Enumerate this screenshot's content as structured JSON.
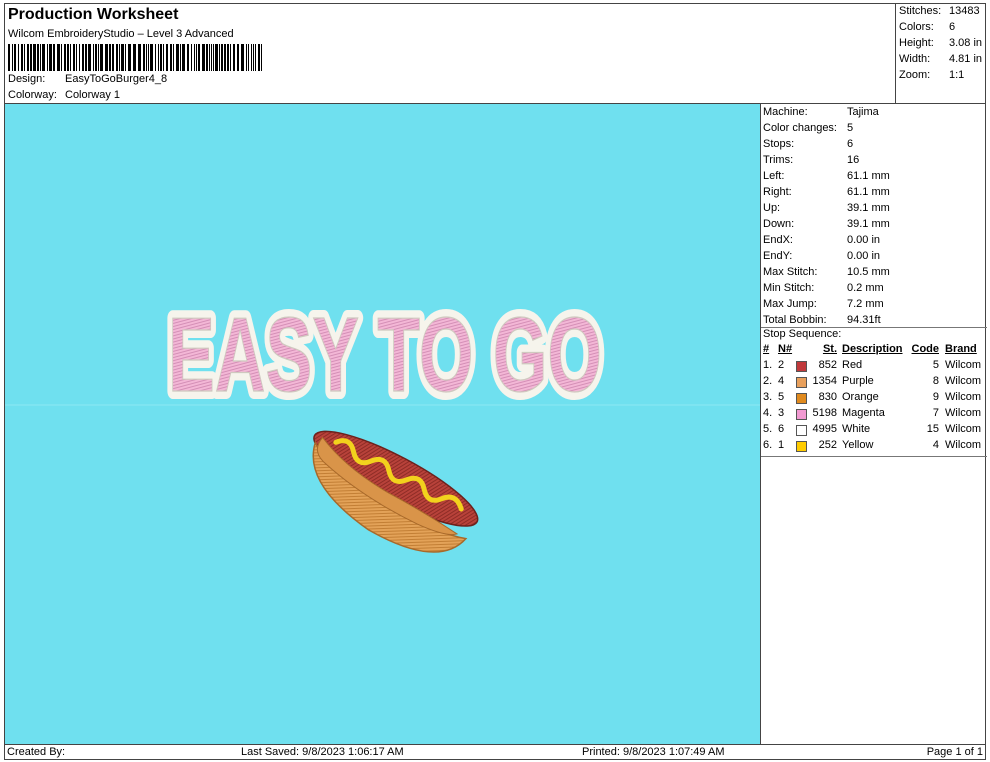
{
  "header": {
    "title": "Production Worksheet",
    "software": "Wilcom EmbroideryStudio – Level 3 Advanced",
    "design_label": "Design:",
    "design_value": "EasyToGoBurger4_8",
    "colorway_label": "Colorway:",
    "colorway_value": "Colorway 1"
  },
  "summary": [
    {
      "label": "Stitches:",
      "value": "13483"
    },
    {
      "label": "Colors:",
      "value": "6"
    },
    {
      "label": "Height:",
      "value": "3.08 in"
    },
    {
      "label": "Width:",
      "value": "4.81 in"
    },
    {
      "label": "Zoom:",
      "value": "1:1"
    }
  ],
  "info": [
    {
      "label": "Machine:",
      "value": "Tajima"
    },
    {
      "label": "Color changes:",
      "value": "5"
    },
    {
      "label": "Stops:",
      "value": "6"
    },
    {
      "label": "Trims:",
      "value": "16"
    },
    {
      "label": "Left:",
      "value": "61.1 mm"
    },
    {
      "label": "Right:",
      "value": "61.1 mm"
    },
    {
      "label": "Up:",
      "value": "39.1 mm"
    },
    {
      "label": "Down:",
      "value": "39.1 mm"
    },
    {
      "label": "EndX:",
      "value": "0.00 in"
    },
    {
      "label": "EndY:",
      "value": "0.00 in"
    },
    {
      "label": "Max Stitch:",
      "value": "10.5 mm"
    },
    {
      "label": "Min Stitch:",
      "value": "0.2 mm"
    },
    {
      "label": "Max Jump:",
      "value": "7.2 mm"
    },
    {
      "label": "Total Bobbin:",
      "value": "94.31ft"
    }
  ],
  "stop_sequence": {
    "title": "Stop Sequence:",
    "headers": {
      "idx": "#",
      "n": "N#",
      "st": "St.",
      "desc": "Description",
      "code": "Code",
      "brand": "Brand"
    },
    "rows": [
      {
        "idx": "1.",
        "n": "2",
        "color": "#c0393b",
        "st": "852",
        "desc": "Red",
        "code": "5",
        "brand": "Wilcom"
      },
      {
        "idx": "2.",
        "n": "4",
        "color": "#e8a05c",
        "st": "1354",
        "desc": "Purple",
        "code": "8",
        "brand": "Wilcom"
      },
      {
        "idx": "3.",
        "n": "5",
        "color": "#e08a1e",
        "st": "830",
        "desc": "Orange",
        "code": "9",
        "brand": "Wilcom"
      },
      {
        "idx": "4.",
        "n": "3",
        "color": "#f29ad2",
        "st": "5198",
        "desc": "Magenta",
        "code": "7",
        "brand": "Wilcom"
      },
      {
        "idx": "5.",
        "n": "6",
        "color": "#ffffff",
        "st": "4995",
        "desc": "White",
        "code": "15",
        "brand": "Wilcom"
      },
      {
        "idx": "6.",
        "n": "1",
        "color": "#ffcc00",
        "st": "252",
        "desc": "Yellow",
        "code": "4",
        "brand": "Wilcom"
      }
    ]
  },
  "design_artwork": {
    "text": "EASY TO GO",
    "background_color": "#6fe0ef",
    "letter_fill": "#f3b7d6",
    "letter_outline": "#f6f4ec"
  },
  "footer": {
    "created_by": "Created By:",
    "last_saved": "Last Saved: 9/8/2023 1:06:17 AM",
    "printed": "Printed: 9/8/2023 1:07:49 AM",
    "page": "Page 1 of 1"
  }
}
